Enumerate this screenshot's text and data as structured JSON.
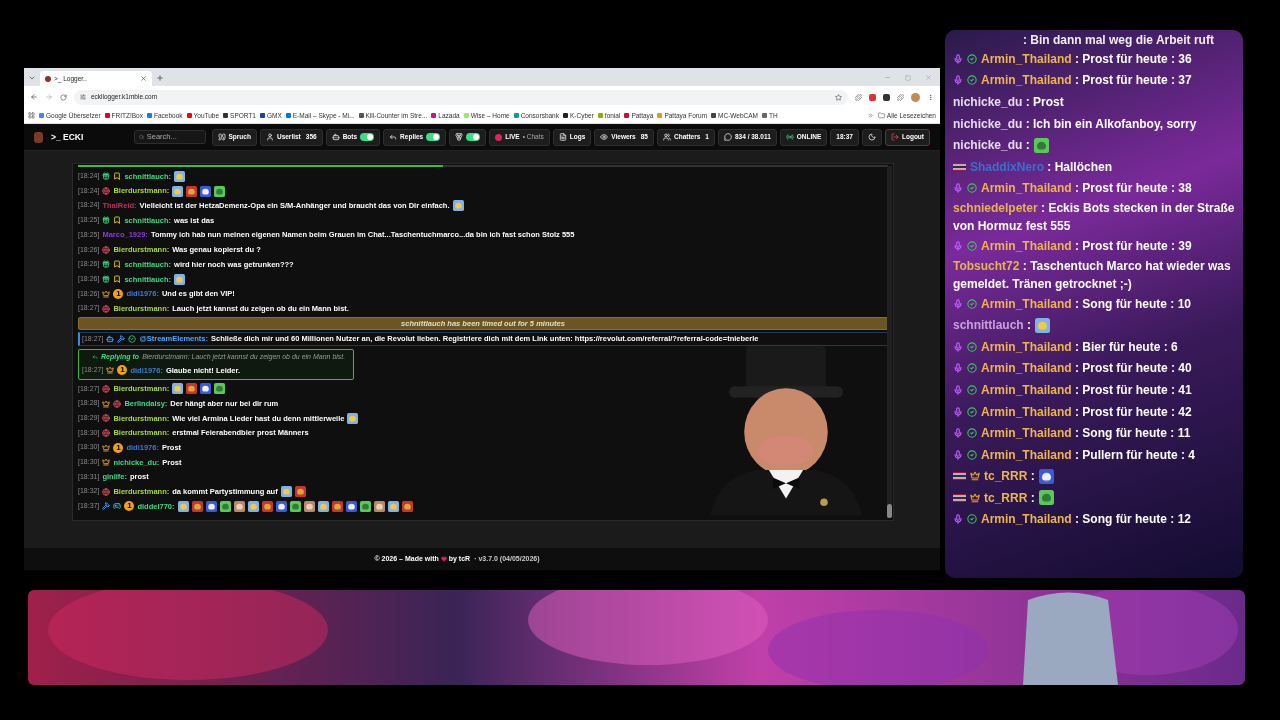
{
  "browser": {
    "tab": {
      "title": ">_ Logger..",
      "selected": true
    },
    "url": "eckilogger.k1mble.com",
    "bookmarks": [
      {
        "label": "Google Übersetzer",
        "color": "#4285f4"
      },
      {
        "label": "FRITZ!Box",
        "color": "#e2001a"
      },
      {
        "label": "Facebook",
        "color": "#1877f2"
      },
      {
        "label": "YouTube",
        "color": "#ff0000"
      },
      {
        "label": "SPORT1",
        "color": "#333333"
      },
      {
        "label": "GMX",
        "color": "#1c449b"
      },
      {
        "label": "E-Mail – Skype - Mi...",
        "color": "#0078d4"
      },
      {
        "label": "Kill-Counter im Stre...",
        "color": "#555555"
      },
      {
        "label": "Lazada",
        "color": "#c0158c"
      },
      {
        "label": "Wise – Home",
        "color": "#9fe870"
      },
      {
        "label": "Consorsbank",
        "color": "#00a0a0"
      },
      {
        "label": "K-Cyber",
        "color": "#222222"
      },
      {
        "label": "fonial",
        "color": "#8cb000"
      },
      {
        "label": "Pattaya",
        "color": "#c8102e"
      },
      {
        "label": "Pattaya Forum",
        "color": "#d4a017"
      },
      {
        "label": "MC-WebCAM",
        "color": "#444444"
      },
      {
        "label": "TH",
        "color": "#666666"
      }
    ],
    "all_bookmarks": "Alle Lesezeichen"
  },
  "app": {
    "logo": ">_ ECKI",
    "search": {
      "placeholder": "Search..."
    },
    "controls": [
      {
        "kind": "button",
        "label": "Spruch"
      },
      {
        "kind": "button",
        "label": "Userlist",
        "count": "356"
      },
      {
        "kind": "toggle",
        "label": "Bots",
        "on": true
      },
      {
        "kind": "toggle",
        "label": "Replies",
        "on": true
      },
      {
        "kind": "toggle",
        "on": true
      },
      {
        "kind": "live",
        "label": "LIVE",
        "sub": "• Chats"
      },
      {
        "kind": "button",
        "label": "Logs"
      },
      {
        "kind": "button",
        "label": "Viewers",
        "count": "85"
      },
      {
        "kind": "button",
        "label": "Chatters",
        "count": "1"
      },
      {
        "kind": "button",
        "label": "834 / 38.011"
      },
      {
        "kind": "status",
        "label": "ONLINE"
      },
      {
        "kind": "button",
        "label": "18:37"
      },
      {
        "kind": "button"
      },
      {
        "kind": "logout",
        "label": "Logout"
      }
    ]
  },
  "log": {
    "progress": {
      "level": 0.45
    },
    "rows": [
      {
        "kind": "message",
        "time": "[18:24]",
        "badges": [
          {
            "kind": "gift"
          },
          {
            "kind": "tag"
          }
        ],
        "user": "schnittlauch:",
        "color": "#3ddc84",
        "emotes": [
          {
            "kind": "picture"
          }
        ]
      },
      {
        "kind": "message",
        "time": "[18:24]",
        "badges": [
          {
            "kind": "globe"
          }
        ],
        "user": "Bierdurstmann:",
        "color": "#a6d83a",
        "emotes": [
          {
            "kind": "picture"
          },
          {
            "kind": "picture"
          },
          {
            "kind": "picture"
          },
          {
            "kind": "picture"
          }
        ]
      },
      {
        "kind": "message",
        "time": "[18:24]",
        "user": "ThaiReid:",
        "color": "#c0305a",
        "text": "Vielleicht ist der HetzaDemenz-Opa ein S/M-Anhänger und braucht das von Dir einfach.",
        "emotes": [
          {
            "kind": "picture"
          }
        ]
      },
      {
        "kind": "message",
        "time": "[18:25]",
        "badges": [
          {
            "kind": "gift"
          },
          {
            "kind": "tag"
          }
        ],
        "user": "schnittlauch:",
        "color": "#3ddc84",
        "text": "was ist das"
      },
      {
        "kind": "message",
        "time": "[18:25]",
        "user": "Marco_1929:",
        "color": "#8a3ad8",
        "text": "Tommy ich hab nun meinen eigenen Namen beim Grauen im Chat...Taschentuchmarco...da bin ich fast schon Stolz 555"
      },
      {
        "kind": "message",
        "time": "[18:26]",
        "badges": [
          {
            "kind": "globe"
          }
        ],
        "user": "Bierdurstmann:",
        "color": "#a6d83a",
        "text": "Was genau kopierst du ?"
      },
      {
        "kind": "message",
        "time": "[18:26]",
        "badges": [
          {
            "kind": "gift"
          },
          {
            "kind": "tag"
          }
        ],
        "user": "schnittlauch:",
        "color": "#3ddc84",
        "text": "wird hier noch was getrunken???"
      },
      {
        "kind": "message",
        "time": "[18:26]",
        "badges": [
          {
            "kind": "gift"
          },
          {
            "kind": "tag"
          }
        ],
        "user": "schnittlauch:",
        "color": "#3ddc84",
        "emotes": [
          {
            "kind": "picture"
          }
        ]
      },
      {
        "kind": "message",
        "time": "[18:26]",
        "badges": [
          {
            "kind": "crown"
          },
          {
            "kind": "coin",
            "text": "1"
          }
        ],
        "user": "didi1976:",
        "color": "#3a7bd5",
        "text": "Und es gibt den VIP!"
      },
      {
        "kind": "message",
        "time": "[18:27]",
        "badges": [
          {
            "kind": "globe"
          }
        ],
        "user": "Bierdurstmann:",
        "color": "#a6d83a",
        "text": "Lauch jetzt kannst du zeigen ob du ein Mann bist."
      },
      {
        "kind": "notice",
        "text": "schnittlauch has been timed out for 5 minutes"
      },
      {
        "kind": "announcement",
        "time": "[18:27]",
        "badges": [
          {
            "kind": "robot"
          },
          {
            "kind": "hammer"
          },
          {
            "kind": "verified"
          }
        ],
        "user": "@StreamElements:",
        "color": "#4aa8ff",
        "text": "Schließe dich mir und 60 Millionen Nutzer an, die Revolut lieben. Registriere dich mit dem Link unten: https://revolut.com/referral/?referral-code=tnieberle"
      },
      {
        "kind": "reply",
        "label": "Replying to",
        "quote": "Bierdurstmann: Lauch jetzt kannst du zeigen ob du ein Mann bist.",
        "time": "[18:27]",
        "badges": [
          {
            "kind": "crown"
          },
          {
            "kind": "coin",
            "text": "1"
          }
        ],
        "user": "didi1976:",
        "color": "#3a7bd5",
        "text": "Glaube nicht! Leider."
      },
      {
        "kind": "message",
        "time": "[18:27]",
        "badges": [
          {
            "kind": "globe"
          }
        ],
        "user": "Bierdurstmann:",
        "color": "#a6d83a",
        "emotes": [
          {
            "kind": "picture"
          },
          {
            "kind": "picture"
          },
          {
            "kind": "picture"
          },
          {
            "kind": "picture"
          }
        ]
      },
      {
        "kind": "message",
        "time": "[18:28]",
        "badges": [
          {
            "kind": "crown"
          },
          {
            "kind": "globe"
          }
        ],
        "user": "Berlindaisy:",
        "color": "#3ddc84",
        "text": "Der hängt aber nur bei dir rum"
      },
      {
        "kind": "message",
        "time": "[18:29]",
        "badges": [
          {
            "kind": "globe"
          }
        ],
        "user": "Bierdurstmann:",
        "color": "#a6d83a",
        "text": "Wie viel Armina Lieder hast du denn mittlerweile",
        "emotes": [
          {
            "kind": "picture"
          }
        ]
      },
      {
        "kind": "message",
        "time": "[18:30]",
        "badges": [
          {
            "kind": "globe"
          }
        ],
        "user": "Bierdurstmann:",
        "color": "#a6d83a",
        "text": "erstmal Feierabendbier prost Männers"
      },
      {
        "kind": "message",
        "time": "[18:30]",
        "badges": [
          {
            "kind": "crown"
          },
          {
            "kind": "coin",
            "text": "1"
          }
        ],
        "user": "didi1976:",
        "color": "#3a7bd5",
        "text": "Prost"
      },
      {
        "kind": "message",
        "time": "[18:30]",
        "badges": [
          {
            "kind": "crown"
          }
        ],
        "user": "nichicke_du:",
        "color": "#3ddc84",
        "text": "Prost"
      },
      {
        "kind": "message",
        "time": "[18:31]",
        "user": "ginlife:",
        "color": "#3ddc84",
        "text": "prost"
      },
      {
        "kind": "message",
        "time": "[18:32]",
        "badges": [
          {
            "kind": "globe"
          }
        ],
        "user": "Bierdurstmann:",
        "color": "#a6d83a",
        "text": "da kommt Partystimmung auf",
        "emotes": [
          {
            "kind": "picture"
          },
          {
            "kind": "picture"
          }
        ]
      },
      {
        "kind": "message",
        "time": "[18:37]",
        "badges": [
          {
            "kind": "hammer"
          },
          {
            "kind": "controller"
          },
          {
            "kind": "coin",
            "text": "1"
          }
        ],
        "user": "diddel770:",
        "color": "#3ddc84",
        "emotes": [
          {
            "kind": "picture"
          },
          {
            "kind": "picture"
          },
          {
            "kind": "picture"
          },
          {
            "kind": "picture"
          },
          {
            "kind": "picture"
          },
          {
            "kind": "picture"
          },
          {
            "kind": "picture"
          },
          {
            "kind": "picture"
          },
          {
            "kind": "picture"
          },
          {
            "kind": "picture"
          },
          {
            "kind": "picture"
          },
          {
            "kind": "picture"
          },
          {
            "kind": "picture"
          },
          {
            "kind": "picture"
          },
          {
            "kind": "picture"
          },
          {
            "kind": "picture"
          },
          {
            "kind": "picture"
          }
        ]
      }
    ]
  },
  "footer": {
    "text": "© 2026 – Made with",
    "by": "by tcR",
    "version": "· v3.7.0 (04/05/2026)"
  },
  "overlay_chat": [
    {
      "kind": "partial",
      "text": ": Bin dann mal weg die Arbeit ruft"
    },
    {
      "kind": "message",
      "badges": [
        {
          "kind": "mic"
        },
        {
          "kind": "check"
        }
      ],
      "user": "Armin_Thailand",
      "color": "#f0b54a",
      "text": ": Prost für heute : 36"
    },
    {
      "kind": "message",
      "badges": [
        {
          "kind": "mic"
        },
        {
          "kind": "check"
        }
      ],
      "user": "Armin_Thailand",
      "color": "#f0b54a",
      "text": ": Prost für heute : 37"
    },
    {
      "kind": "message",
      "user": "nichicke_du",
      "color": "#e6dcf0",
      "text": ": Prost"
    },
    {
      "kind": "message",
      "user": "nichicke_du",
      "color": "#e6dcf0",
      "text": ": Ich bin ein Alkofanboy, sorry"
    },
    {
      "kind": "message",
      "user": "nichicke_du",
      "color": "#e6dcf0",
      "text": ":",
      "emotes": [
        {
          "kind": "picture"
        }
      ]
    },
    {
      "kind": "message",
      "badges": [
        {
          "kind": "flag"
        }
      ],
      "user": "ShaddixNero",
      "color": "#3a6fd0",
      "text": ": Hallöchen"
    },
    {
      "kind": "message",
      "badges": [
        {
          "kind": "mic"
        },
        {
          "kind": "check"
        }
      ],
      "user": "Armin_Thailand",
      "color": "#f0b54a",
      "text": ": Prost für heute : 38"
    },
    {
      "kind": "message",
      "user": "schniedelpeter",
      "color": "#e8b44a",
      "text": ": Eckis Bots stecken in der Straße von Hormuz fest 555"
    },
    {
      "kind": "message",
      "badges": [
        {
          "kind": "mic"
        },
        {
          "kind": "check"
        }
      ],
      "user": "Armin_Thailand",
      "color": "#f0b54a",
      "text": ": Prost für heute : 39"
    },
    {
      "kind": "message",
      "user": "Tobsucht72",
      "color": "#e8b44a",
      "text": ": Taschentuch Marco hat wieder was gemeldet. Tränen getrocknet ;-)"
    },
    {
      "kind": "message",
      "badges": [
        {
          "kind": "mic"
        },
        {
          "kind": "check"
        }
      ],
      "user": "Armin_Thailand",
      "color": "#f0b54a",
      "text": ": Song für heute : 10"
    },
    {
      "kind": "message",
      "user": "schnittlauch",
      "color": "#c9a0e0",
      "text": ":",
      "emotes": [
        {
          "kind": "picture"
        }
      ]
    },
    {
      "kind": "message",
      "badges": [
        {
          "kind": "mic"
        },
        {
          "kind": "check"
        }
      ],
      "user": "Armin_Thailand",
      "color": "#f0b54a",
      "text": ": Bier für heute : 6"
    },
    {
      "kind": "message",
      "badges": [
        {
          "kind": "mic"
        },
        {
          "kind": "check"
        }
      ],
      "user": "Armin_Thailand",
      "color": "#f0b54a",
      "text": ": Prost für heute : 40"
    },
    {
      "kind": "message",
      "badges": [
        {
          "kind": "mic"
        },
        {
          "kind": "check"
        }
      ],
      "user": "Armin_Thailand",
      "color": "#f0b54a",
      "text": ": Prost für heute : 41"
    },
    {
      "kind": "message",
      "badges": [
        {
          "kind": "mic"
        },
        {
          "kind": "check"
        }
      ],
      "user": "Armin_Thailand",
      "color": "#f0b54a",
      "text": ": Prost für heute : 42"
    },
    {
      "kind": "message",
      "badges": [
        {
          "kind": "mic"
        },
        {
          "kind": "check"
        }
      ],
      "user": "Armin_Thailand",
      "color": "#f0b54a",
      "text": ": Song für heute : 11"
    },
    {
      "kind": "message",
      "badges": [
        {
          "kind": "mic"
        },
        {
          "kind": "check"
        }
      ],
      "user": "Armin_Thailand",
      "color": "#f0b54a",
      "text": ": Pullern für heute : 4"
    },
    {
      "kind": "message",
      "badges": [
        {
          "kind": "flag"
        },
        {
          "kind": "crown"
        }
      ],
      "user": "tc_RRR",
      "color": "#f0b54a",
      "text": ":",
      "emotes": [
        {
          "kind": "picture"
        }
      ]
    },
    {
      "kind": "message",
      "badges": [
        {
          "kind": "flag"
        },
        {
          "kind": "crown"
        }
      ],
      "user": "tc_RRR",
      "color": "#f0b54a",
      "text": ":",
      "emotes": [
        {
          "kind": "picture"
        }
      ]
    },
    {
      "kind": "message",
      "badges": [
        {
          "kind": "mic"
        },
        {
          "kind": "check"
        }
      ],
      "user": "Armin_Thailand",
      "color": "#f0b54a",
      "text": ": Song für heute : 12"
    }
  ]
}
